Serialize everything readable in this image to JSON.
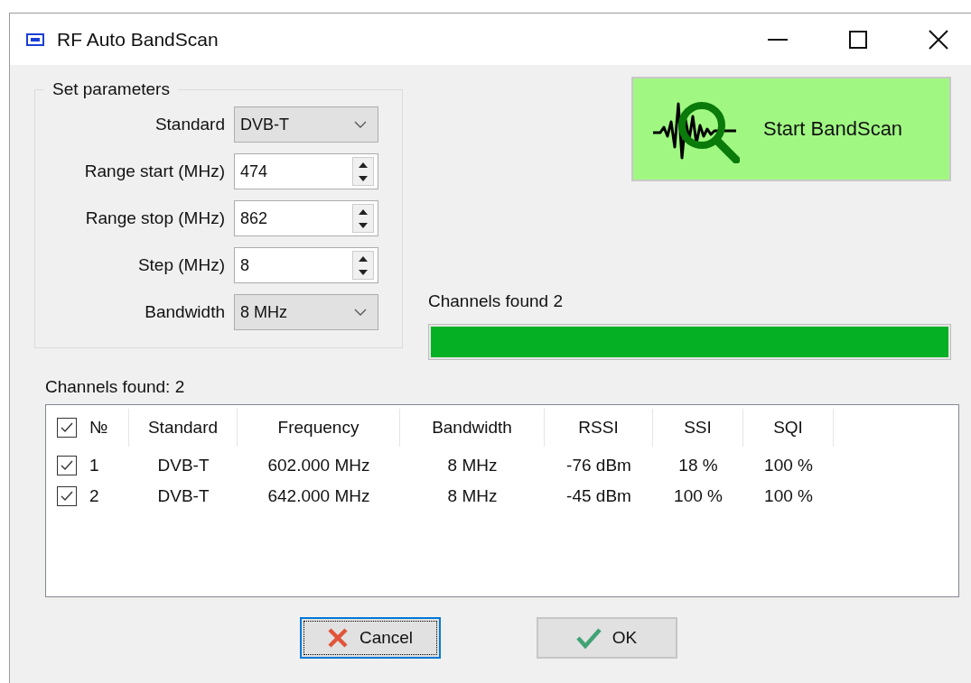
{
  "window": {
    "title": "RF Auto BandScan"
  },
  "parameters": {
    "title": "Set parameters",
    "fields": [
      {
        "label": "Standard",
        "kind": "combo",
        "value": "DVB-T"
      },
      {
        "label": "Range start (MHz)",
        "kind": "spin",
        "value": "474"
      },
      {
        "label": "Range stop (MHz)",
        "kind": "spin",
        "value": "862"
      },
      {
        "label": "Step (MHz)",
        "kind": "spin",
        "value": "8"
      },
      {
        "label": "Bandwidth",
        "kind": "combo",
        "value": "8 MHz"
      }
    ]
  },
  "scan_button": {
    "label": "Start BandScan"
  },
  "progress": {
    "label": "Channels found 2",
    "level": 1.0
  },
  "table": {
    "caption": "Channels found: 2",
    "header_checked": true,
    "columns": [
      "№",
      "Standard",
      "Frequency",
      "Bandwidth",
      "RSSI",
      "SSI",
      "SQI"
    ],
    "rows": [
      {
        "checked": true,
        "cells": [
          "1",
          "DVB-T",
          "602.000 MHz",
          "8 MHz",
          "-76 dBm",
          "18 %",
          "100 %"
        ]
      },
      {
        "checked": true,
        "cells": [
          "2",
          "DVB-T",
          "642.000 MHz",
          "8 MHz",
          "-45 dBm",
          "100 %",
          "100 %"
        ]
      }
    ]
  },
  "buttons": [
    {
      "label": "Cancel",
      "kind": "cancel",
      "focused": true
    },
    {
      "label": "OK",
      "kind": "ok",
      "focused": false
    }
  ]
}
